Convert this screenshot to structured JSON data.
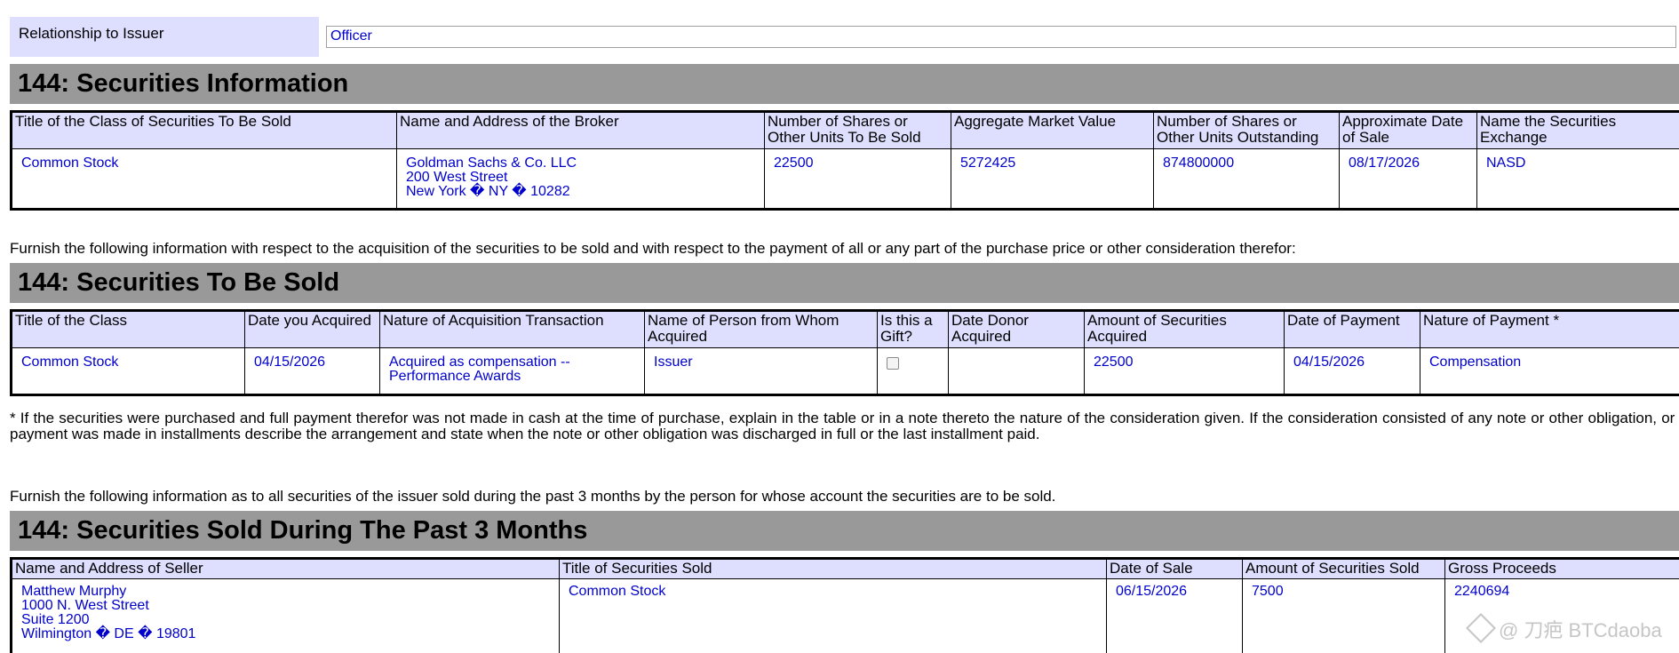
{
  "relationship": {
    "label": "Relationship to Issuer",
    "value": "Officer"
  },
  "section_info": {
    "title": "144: Securities Information",
    "headers": [
      "Title of the Class of Securities To Be Sold",
      "Name and Address of the Broker",
      "Number of Shares or Other Units To Be Sold",
      "Aggregate Market Value",
      "Number of Shares or Other Units Outstanding",
      "Approximate Date of Sale",
      "Name the Securities Exchange"
    ],
    "row": {
      "class": "Common Stock",
      "broker_name": "Goldman Sachs & Co. LLC",
      "broker_street": "200 West Street",
      "broker_city": "New York � NY � 10282",
      "units": "22500",
      "market_value": "5272425",
      "outstanding": "874800000",
      "date": "08/17/2026",
      "exchange": "NASD"
    }
  },
  "furnish_1": "Furnish the following information with respect to the acquisition of the securities to be sold and with respect to the payment of all or any part of the purchase price or other consideration therefor:",
  "section_sold": {
    "title": "144: Securities To Be Sold",
    "headers": [
      "Title of the Class",
      "Date you Acquired",
      "Nature of Acquisition Transaction",
      "Name of Person from Whom Acquired",
      "Is this a Gift?",
      "Date Donor Acquired",
      "Amount of Securities Acquired",
      "Date of Payment",
      "Nature of Payment *"
    ],
    "row": {
      "class": "Common Stock",
      "date_acquired": "04/15/2026",
      "nature_line1": "Acquired as compensation --",
      "nature_line2": "Performance Awards",
      "person": "Issuer",
      "gift_checked": false,
      "donor_date": "",
      "amount": "22500",
      "payment_date": "04/15/2026",
      "payment_nature": "Compensation"
    }
  },
  "footnote": "* If the securities were purchased and full payment therefor was not made in cash at the time of purchase, explain in the table or in a note thereto the nature of the consideration given. If the consideration consisted of any note or other obligation, or if payment was made in installments describe the arrangement and state when the note or other obligation was discharged in full or the last installment paid.",
  "furnish_2": "Furnish the following information as to all securities of the issuer sold during the past 3 months by the person for whose account the securities are to be sold.",
  "section_past": {
    "title": "144: Securities Sold During The Past 3 Months",
    "headers": [
      "Name and Address of Seller",
      "Title of Securities Sold",
      "Date of Sale",
      "Amount of Securities Sold",
      "Gross Proceeds"
    ],
    "row": {
      "seller_name": "Matthew Murphy",
      "seller_street": "1000 N. West Street",
      "seller_suite": "Suite 1200",
      "seller_city": "Wilmington � DE � 19801",
      "title": "Common Stock",
      "date": "06/15/2026",
      "amount": "7500",
      "proceeds": "2240694"
    }
  },
  "watermark": "@ 刀疤 BTCdaoba"
}
